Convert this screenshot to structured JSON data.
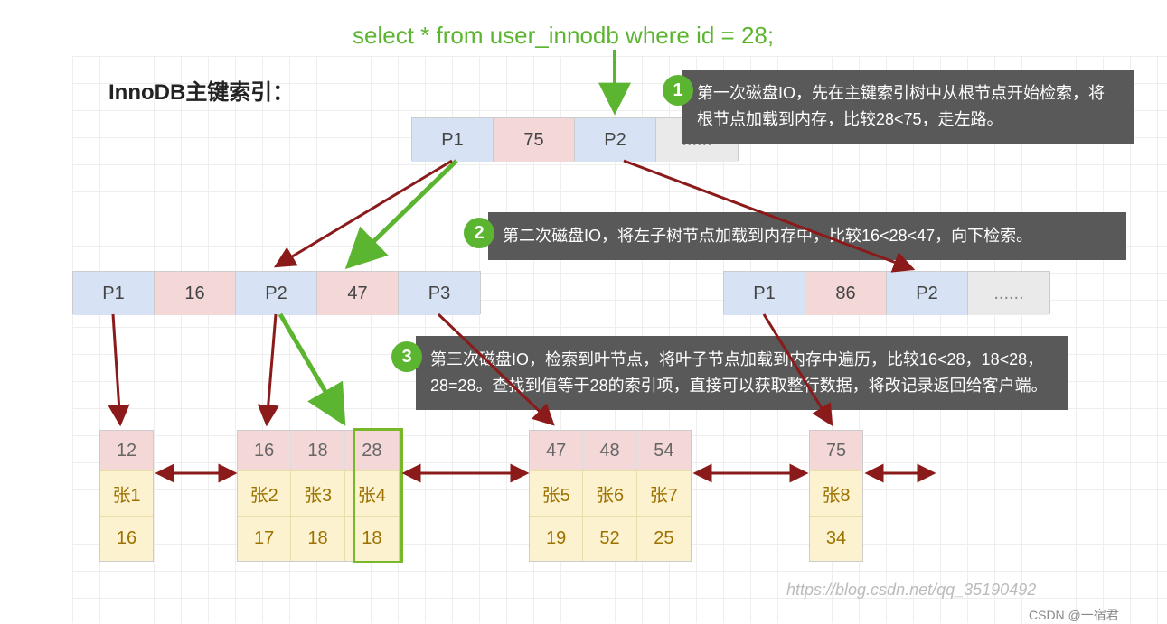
{
  "sql": "select * from user_innodb where id = 28;",
  "section_title": "InnoDB主键索引：",
  "root": {
    "p1": "P1",
    "k": "75",
    "p2": "P2",
    "more": "......"
  },
  "l2_left": {
    "p1": "P1",
    "k1": "16",
    "p2": "P2",
    "k2": "47",
    "p3": "P3"
  },
  "l2_right": {
    "p1": "P1",
    "k1": "86",
    "p2": "P2",
    "more": "......"
  },
  "leaves": {
    "lf1": {
      "keys": [
        "12"
      ],
      "names": [
        "张1"
      ],
      "vals": [
        "16"
      ]
    },
    "lf2": {
      "keys": [
        "16",
        "18",
        "28"
      ],
      "names": [
        "张2",
        "张3",
        "张4"
      ],
      "vals": [
        "17",
        "18",
        "18"
      ]
    },
    "lf3": {
      "keys": [
        "47",
        "48",
        "54"
      ],
      "names": [
        "张5",
        "张6",
        "张7"
      ],
      "vals": [
        "19",
        "52",
        "25"
      ]
    },
    "lf4": {
      "keys": [
        "75"
      ],
      "names": [
        "张8"
      ],
      "vals": [
        "34"
      ]
    }
  },
  "steps": {
    "s1": {
      "n": "1",
      "t": "第一次磁盘IO，先在主键索引树中从根节点开始检索，将根节点加载到内存，比较28<75，走左路。"
    },
    "s2": {
      "n": "2",
      "t": "第二次磁盘IO，将左子树节点加载到内存中，比较16<28<47，向下检索。"
    },
    "s3": {
      "n": "3",
      "t": "第三次磁盘IO，检索到叶节点，将叶子节点加载到内存中遍历，比较16<28，18<28，28=28。查找到值等于28的索引项，直接可以获取整行数据，将改记录返回给客户端。"
    }
  },
  "watermark1": "https://blog.csdn.net/qq_35190492",
  "watermark2": "CSDN @一宿君"
}
